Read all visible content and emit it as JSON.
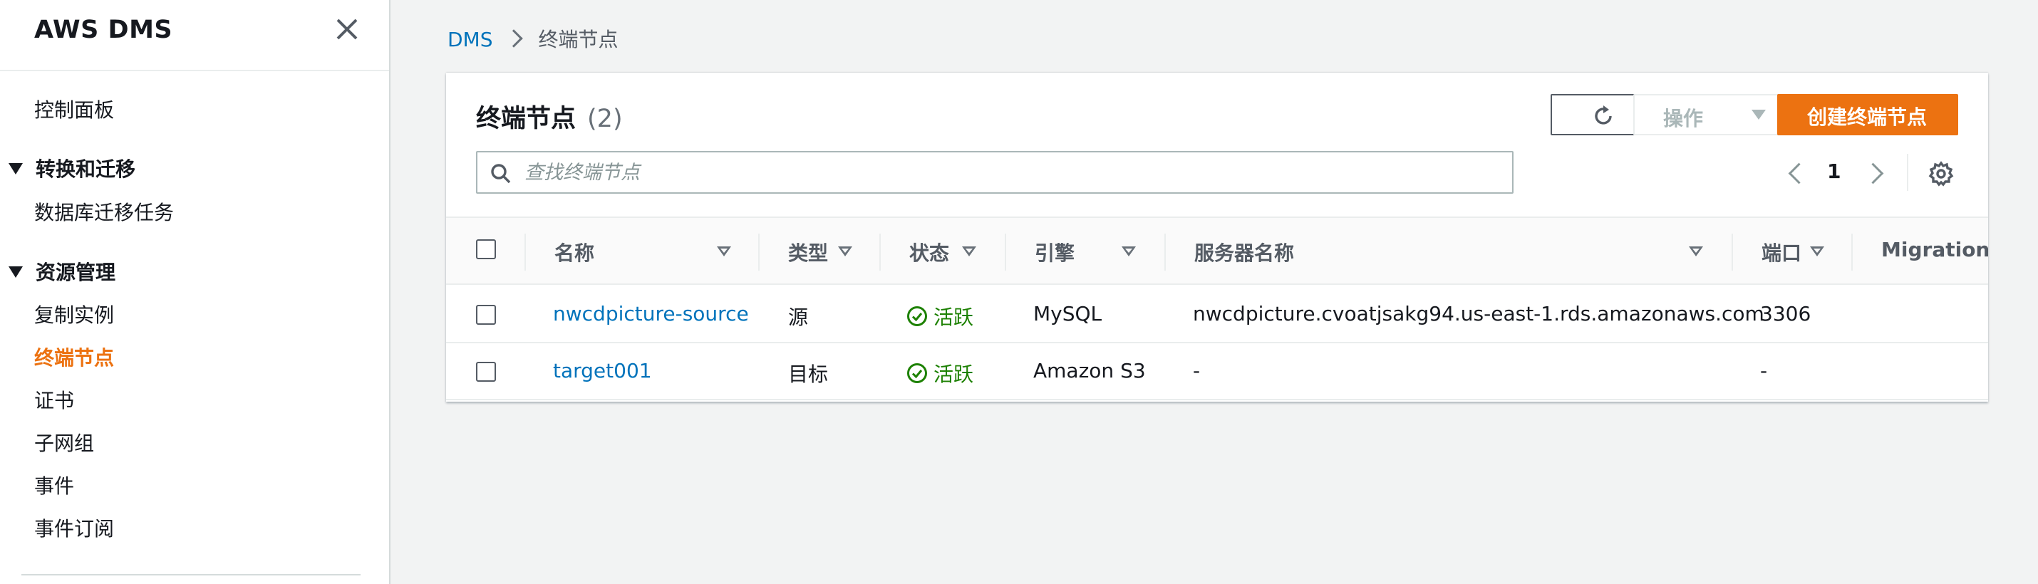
{
  "sidebar": {
    "title": "AWS DMS",
    "items": {
      "dashboard": "控制面板",
      "group_migrate": "转换和迁移",
      "db_tasks": "数据库迁移任务",
      "group_resources": "资源管理",
      "replication_instances": "复制实例",
      "endpoints": "终端节点",
      "certificates": "证书",
      "subnet_groups": "子网组",
      "events": "事件",
      "event_subscriptions": "事件订阅"
    }
  },
  "breadcrumb": {
    "root": "DMS",
    "current": "终端节点"
  },
  "panel": {
    "title": "终端节点",
    "count": "(2)",
    "actions_label": "操作",
    "create_label": "创建终端节点",
    "search_placeholder": "查找终端节点",
    "page": "1"
  },
  "table": {
    "columns": {
      "name": "名称",
      "type": "类型",
      "status": "状态",
      "engine": "引擎",
      "server": "服务器名称",
      "port": "端口",
      "migration": "Migration H"
    },
    "rows": [
      {
        "name": "nwcdpicture-source",
        "type": "源",
        "status": "活跃",
        "engine": "MySQL",
        "server": "nwcdpicture.cvoatjsakg94.us-east-1.rds.amazonaws.com",
        "port": "3306"
      },
      {
        "name": "target001",
        "type": "目标",
        "status": "活跃",
        "engine": "Amazon S3",
        "server": "-",
        "port": "-"
      }
    ]
  },
  "colors": {
    "accent": "#ec7211",
    "link": "#0073bb",
    "success": "#1d8102"
  }
}
